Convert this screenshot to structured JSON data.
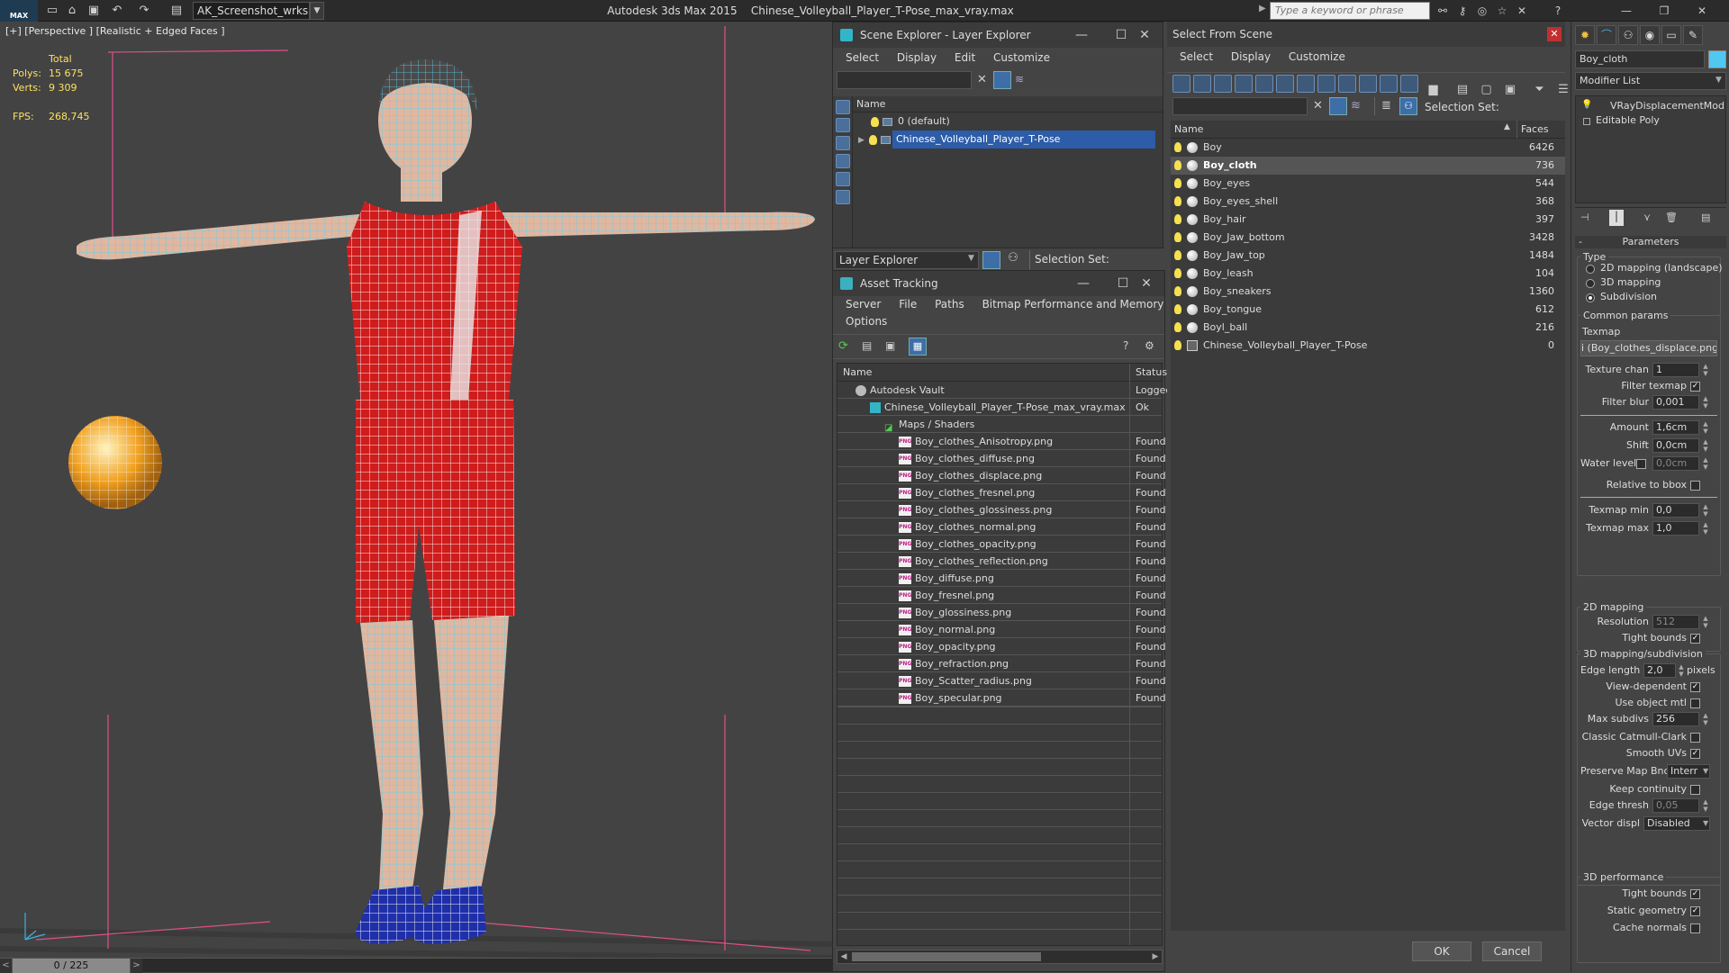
{
  "app": {
    "title": "Autodesk 3ds Max  2015",
    "filename": "Chinese_Volleyball_Player_T-Pose_max_vray.max",
    "logo_text": "MAX",
    "workspace": "AK_Screenshot_wrksp",
    "search_placeholder": "Type a keyword or phrase"
  },
  "viewport": {
    "label": "[+] [Perspective ] [Realistic + Edged Faces ]",
    "stats": {
      "total_label": "Total",
      "polys_label": "Polys:",
      "polys": "15 675",
      "verts_label": "Verts:",
      "verts": "9 309",
      "fps_label": "FPS:",
      "fps": "268,745"
    },
    "timeline": "0 / 225",
    "prev": "<",
    "next": ">"
  },
  "scene_explorer": {
    "title": "Scene Explorer - Layer Explorer",
    "menu": [
      "Select",
      "Display",
      "Edit",
      "Customize"
    ],
    "col_name": "Name",
    "layers": [
      "0 (default)",
      "Chinese_Volleyball_Player_T-Pose"
    ],
    "footer_dropdown": "Layer Explorer",
    "selection_set": "Selection Set:"
  },
  "asset_tracking": {
    "title": "Asset Tracking",
    "menu1": [
      "Server",
      "File",
      "Paths",
      "Bitmap Performance and Memory"
    ],
    "menu2": [
      "Options"
    ],
    "col_name": "Name",
    "col_status": "Status",
    "rows": [
      {
        "name": "Autodesk Vault",
        "status": "Logged"
      },
      {
        "name": "Chinese_Volleyball_Player_T-Pose_max_vray.max",
        "status": "Ok"
      },
      {
        "name": "Maps / Shaders",
        "status": ""
      },
      {
        "name": "Boy_clothes_Anisotropy.png",
        "status": "Found"
      },
      {
        "name": "Boy_clothes_diffuse.png",
        "status": "Found"
      },
      {
        "name": "Boy_clothes_displace.png",
        "status": "Found"
      },
      {
        "name": "Boy_clothes_fresnel.png",
        "status": "Found"
      },
      {
        "name": "Boy_clothes_glossiness.png",
        "status": "Found"
      },
      {
        "name": "Boy_clothes_normal.png",
        "status": "Found"
      },
      {
        "name": "Boy_clothes_opacity.png",
        "status": "Found"
      },
      {
        "name": "Boy_clothes_reflection.png",
        "status": "Found"
      },
      {
        "name": "Boy_diffuse.png",
        "status": "Found"
      },
      {
        "name": "Boy_fresnel.png",
        "status": "Found"
      },
      {
        "name": "Boy_glossiness.png",
        "status": "Found"
      },
      {
        "name": "Boy_normal.png",
        "status": "Found"
      },
      {
        "name": "Boy_opacity.png",
        "status": "Found"
      },
      {
        "name": "Boy_refraction.png",
        "status": "Found"
      },
      {
        "name": "Boy_Scatter_radius.png",
        "status": "Found"
      },
      {
        "name": "Boy_specular.png",
        "status": "Found"
      }
    ],
    "png_badge": "PNG"
  },
  "select_from_scene": {
    "title": "Select From Scene",
    "menu": [
      "Select",
      "Display",
      "Customize"
    ],
    "selection_set": "Selection Set:",
    "col_name": "Name",
    "col_faces": "Faces",
    "rows": [
      {
        "name": "Boy",
        "faces": "6426"
      },
      {
        "name": "Boy_cloth",
        "faces": "736"
      },
      {
        "name": "Boy_eyes",
        "faces": "544"
      },
      {
        "name": "Boy_eyes_shell",
        "faces": "368"
      },
      {
        "name": "Boy_hair",
        "faces": "397"
      },
      {
        "name": "Boy_Jaw_bottom",
        "faces": "3428"
      },
      {
        "name": "Boy_Jaw_top",
        "faces": "1484"
      },
      {
        "name": "Boy_leash",
        "faces": "104"
      },
      {
        "name": "Boy_sneakers",
        "faces": "1360"
      },
      {
        "name": "Boy_tongue",
        "faces": "612"
      },
      {
        "name": "Boyl_ball",
        "faces": "216"
      },
      {
        "name": "Chinese_Volleyball_Player_T-Pose",
        "faces": "0"
      }
    ],
    "ok": "OK",
    "cancel": "Cancel"
  },
  "command_panel": {
    "object_name": "Boy_cloth",
    "modifier_list": "Modifier List",
    "stack": [
      "VRayDisplacementMod",
      "Editable Poly"
    ],
    "rollout": "Parameters",
    "type_label": "Type",
    "types": [
      "2D mapping (landscape)",
      "3D mapping",
      "Subdivision"
    ],
    "common_params": "Common params",
    "texmap_label": "Texmap",
    "texmap_value": "i (Boy_clothes_displace.png)",
    "texture_chan_label": "Texture chan",
    "texture_chan": "1",
    "filter_texmap_label": "Filter texmap",
    "filter_blur_label": "Filter blur",
    "filter_blur": "0,001",
    "amount_label": "Amount",
    "amount": "1,6cm",
    "shift_label": "Shift",
    "shift": "0,0cm",
    "water_level_label": "Water level",
    "water_level": "0,0cm",
    "relative_bbox_label": "Relative to bbox",
    "texmap_min_label": "Texmap min",
    "texmap_min": "0,0",
    "texmap_max_label": "Texmap max",
    "texmap_max": "1,0",
    "mapping2d": "2D mapping",
    "resolution_label": "Resolution",
    "resolution": "512",
    "tight_bounds_label": "Tight bounds",
    "mapping3d": "3D mapping/subdivision",
    "edge_length_label": "Edge length",
    "edge_length": "2,0",
    "pixels_label": "pixels",
    "view_dependent_label": "View-dependent",
    "use_object_mtl_label": "Use object mtl",
    "max_subdivs_label": "Max subdivs",
    "max_subdivs": "256",
    "classic_cc_label": "Classic Catmull-Clark",
    "smooth_uvs_label": "Smooth UVs",
    "preserve_map_label": "Preserve Map Bnd",
    "preserve_map": "Interr",
    "keep_continuity_label": "Keep continuity",
    "edge_thresh_label": "Edge thresh",
    "edge_thresh": "0,05",
    "vector_displ_label": "Vector displ",
    "vector_displ": "Disabled",
    "perf3d": "3D performance",
    "tight_bounds2_label": "Tight bounds",
    "static_geometry_label": "Static geometry",
    "cache_normals_label": "Cache normals"
  }
}
